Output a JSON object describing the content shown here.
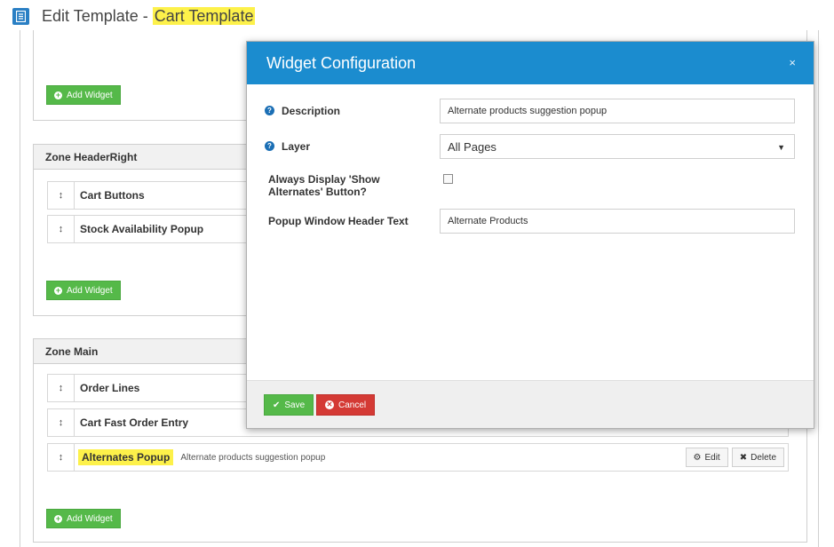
{
  "page": {
    "title_prefix": "Edit Template - ",
    "title_highlight": "Cart Template",
    "icon": "document-icon"
  },
  "zones": {
    "top": {
      "add_widget": "Add Widget"
    },
    "header_right": {
      "title": "Zone HeaderRight",
      "widgets": [
        {
          "name": "Cart Buttons"
        },
        {
          "name": "Stock Availability Popup"
        }
      ],
      "add_widget": "Add Widget"
    },
    "main": {
      "title": "Zone Main",
      "widgets": [
        {
          "name": "Order Lines"
        },
        {
          "name": "Cart Fast Order Entry"
        },
        {
          "name": "Alternates Popup",
          "description": "Alternate products suggestion popup",
          "edit_label": "Edit",
          "delete_label": "Delete"
        }
      ],
      "add_widget": "Add Widget"
    }
  },
  "modal": {
    "title": "Widget Configuration",
    "close_glyph": "×",
    "fields": {
      "description": {
        "label": "Description",
        "value": "Alternate products suggestion popup"
      },
      "layer": {
        "label": "Layer",
        "value": "All Pages"
      },
      "always_display": {
        "label": "Always Display 'Show Alternates' Button?",
        "checked": false
      },
      "popup_header": {
        "label": "Popup Window Header Text",
        "value": "Alternate Products"
      }
    },
    "save_label": "Save",
    "cancel_label": "Cancel"
  },
  "colors": {
    "primary": "#1b8ccf",
    "success": "#55b949",
    "danger": "#d43a35",
    "highlight": "#fdf14a"
  }
}
